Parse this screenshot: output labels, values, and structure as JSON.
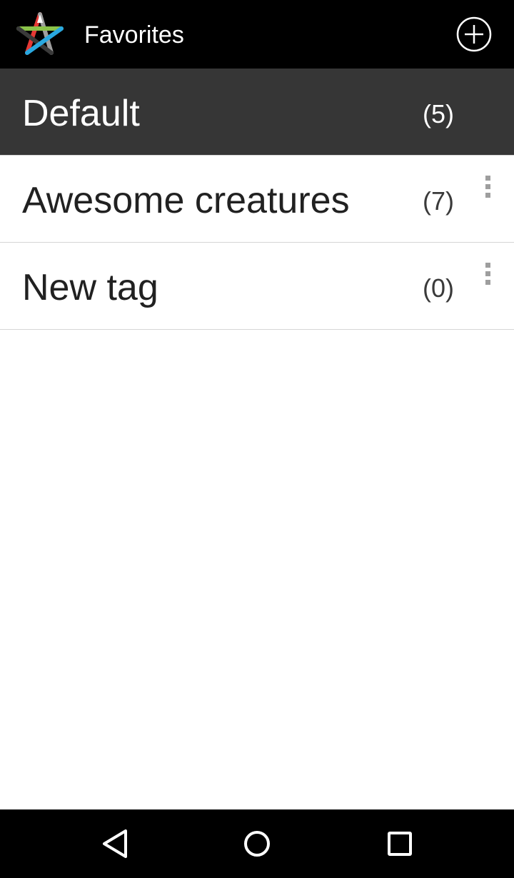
{
  "app_bar": {
    "title": "Favorites",
    "logo_icon": "rainbow-star-icon",
    "add_icon": "add-circle-icon"
  },
  "tags": [
    {
      "name": "Default",
      "count": "(5)",
      "selected": true,
      "has_menu": false
    },
    {
      "name": "Awesome creatures",
      "count": "(7)",
      "selected": false,
      "has_menu": true
    },
    {
      "name": "New tag",
      "count": "(0)",
      "selected": false,
      "has_menu": true
    }
  ],
  "nav_bar": {
    "back_icon": "back-triangle-icon",
    "home_icon": "home-circle-icon",
    "recents_icon": "recents-square-icon"
  },
  "colors": {
    "app_bar_bg": "#000000",
    "selected_row_bg": "#363636",
    "divider": "#d6d6d6",
    "logo_green": "#8bc34a",
    "logo_blue": "#29a8e0",
    "logo_red": "#e53935",
    "logo_gray": "#9e9e9e"
  }
}
